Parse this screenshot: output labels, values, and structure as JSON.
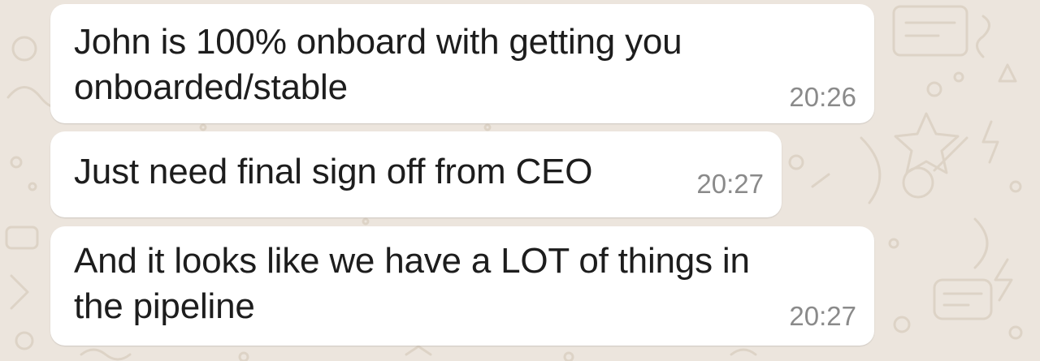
{
  "colors": {
    "background": "#ece5dd",
    "bubble": "#ffffff",
    "text": "#1d1d1d",
    "timestamp": "#8a8a8a"
  },
  "messages": [
    {
      "text": "John is 100% onboard with getting you\nonboarded/stable",
      "time": "20:26"
    },
    {
      "text": "Just need final sign off from CEO",
      "time": "20:27"
    },
    {
      "text": "And it looks like we have a LOT of things in\nthe pipeline",
      "time": "20:27"
    }
  ]
}
